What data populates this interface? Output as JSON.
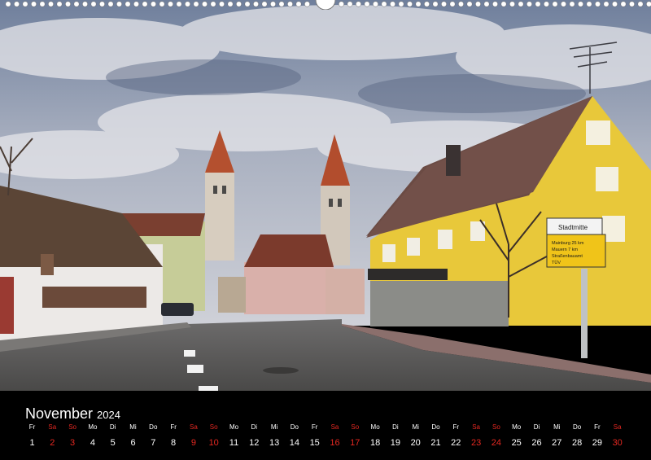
{
  "calendar": {
    "month": "November",
    "year": "2024",
    "weekend_color": "#e52821",
    "days": [
      {
        "wd": "Fr",
        "n": "1",
        "we": false
      },
      {
        "wd": "Sa",
        "n": "2",
        "we": true
      },
      {
        "wd": "So",
        "n": "3",
        "we": true
      },
      {
        "wd": "Mo",
        "n": "4",
        "we": false
      },
      {
        "wd": "Di",
        "n": "5",
        "we": false
      },
      {
        "wd": "Mi",
        "n": "6",
        "we": false
      },
      {
        "wd": "Do",
        "n": "7",
        "we": false
      },
      {
        "wd": "Fr",
        "n": "8",
        "we": false
      },
      {
        "wd": "Sa",
        "n": "9",
        "we": true
      },
      {
        "wd": "So",
        "n": "10",
        "we": true
      },
      {
        "wd": "Mo",
        "n": "11",
        "we": false
      },
      {
        "wd": "Di",
        "n": "12",
        "we": false
      },
      {
        "wd": "Mi",
        "n": "13",
        "we": false
      },
      {
        "wd": "Do",
        "n": "14",
        "we": false
      },
      {
        "wd": "Fr",
        "n": "15",
        "we": false
      },
      {
        "wd": "Sa",
        "n": "16",
        "we": true
      },
      {
        "wd": "So",
        "n": "17",
        "we": true
      },
      {
        "wd": "Mo",
        "n": "18",
        "we": false
      },
      {
        "wd": "Di",
        "n": "19",
        "we": false
      },
      {
        "wd": "Mi",
        "n": "20",
        "we": false
      },
      {
        "wd": "Do",
        "n": "21",
        "we": false
      },
      {
        "wd": "Fr",
        "n": "22",
        "we": false
      },
      {
        "wd": "Sa",
        "n": "23",
        "we": true
      },
      {
        "wd": "So",
        "n": "24",
        "we": true
      },
      {
        "wd": "Mo",
        "n": "25",
        "we": false
      },
      {
        "wd": "Di",
        "n": "26",
        "we": false
      },
      {
        "wd": "Mi",
        "n": "27",
        "we": false
      },
      {
        "wd": "Do",
        "n": "28",
        "we": false
      },
      {
        "wd": "Fr",
        "n": "29",
        "we": false
      },
      {
        "wd": "Sa",
        "n": "30",
        "we": true
      }
    ]
  },
  "photo": {
    "signs": {
      "stadtmitte": "Stadtmitte",
      "route_1": "Mainburg 25 km",
      "route_2": "Mauern 7 km",
      "route_3": "Straßenbauamt",
      "route_4": "TÜV"
    }
  }
}
